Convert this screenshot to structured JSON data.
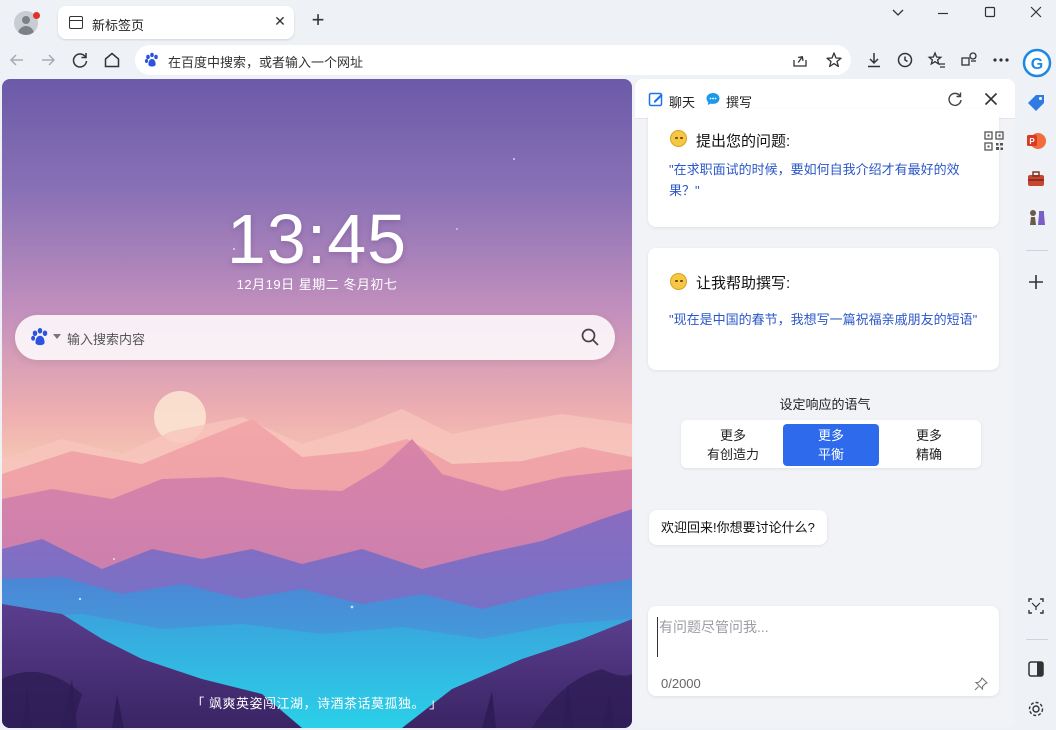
{
  "browser": {
    "tab": {
      "title": "新标签页"
    },
    "address": {
      "text": "在百度中搜索，或者输入一个网址"
    }
  },
  "ntp": {
    "clock": "13:45",
    "date": "12月19日 星期二 冬月初七",
    "search_placeholder": "输入搜索内容",
    "quote": "「 飒爽英姿闯江湖，诗酒茶话莫孤独。 」"
  },
  "copilot": {
    "tabs": [
      {
        "label": "聊天"
      },
      {
        "label": "撰写"
      }
    ],
    "cards": [
      {
        "title": "提出您的问题:",
        "body": "\"在求职面试的时候，要如何自我介绍才有最好的效果？\""
      },
      {
        "title": "让我帮助撰写:",
        "body": "\"现在是中国的春节，我想写一篇祝福亲戚朋友的短语\""
      }
    ],
    "tone_label": "设定响应的语气",
    "tones": [
      {
        "line1": "更多",
        "line2": "有创造力",
        "selected": false
      },
      {
        "line1": "更多",
        "line2": "平衡",
        "selected": true
      },
      {
        "line1": "更多",
        "line2": "精确",
        "selected": false
      }
    ],
    "welcome": "欢迎回来!你想要讨论什么?",
    "input_placeholder": "有问题尽管问我...",
    "counter": "0/2000"
  },
  "colors": {
    "accent": "#2d6bec",
    "link_text": "#2b57c8",
    "panel_bg": "#f1f3f6",
    "chrome_bg": "#eef1f6"
  },
  "icons": {
    "sidebar": [
      "copilot-icon",
      "tag-icon",
      "office-icon",
      "toolbox-icon",
      "chess-icon",
      "add-icon",
      "screenshot-icon",
      "split-view-icon",
      "settings-icon"
    ]
  }
}
